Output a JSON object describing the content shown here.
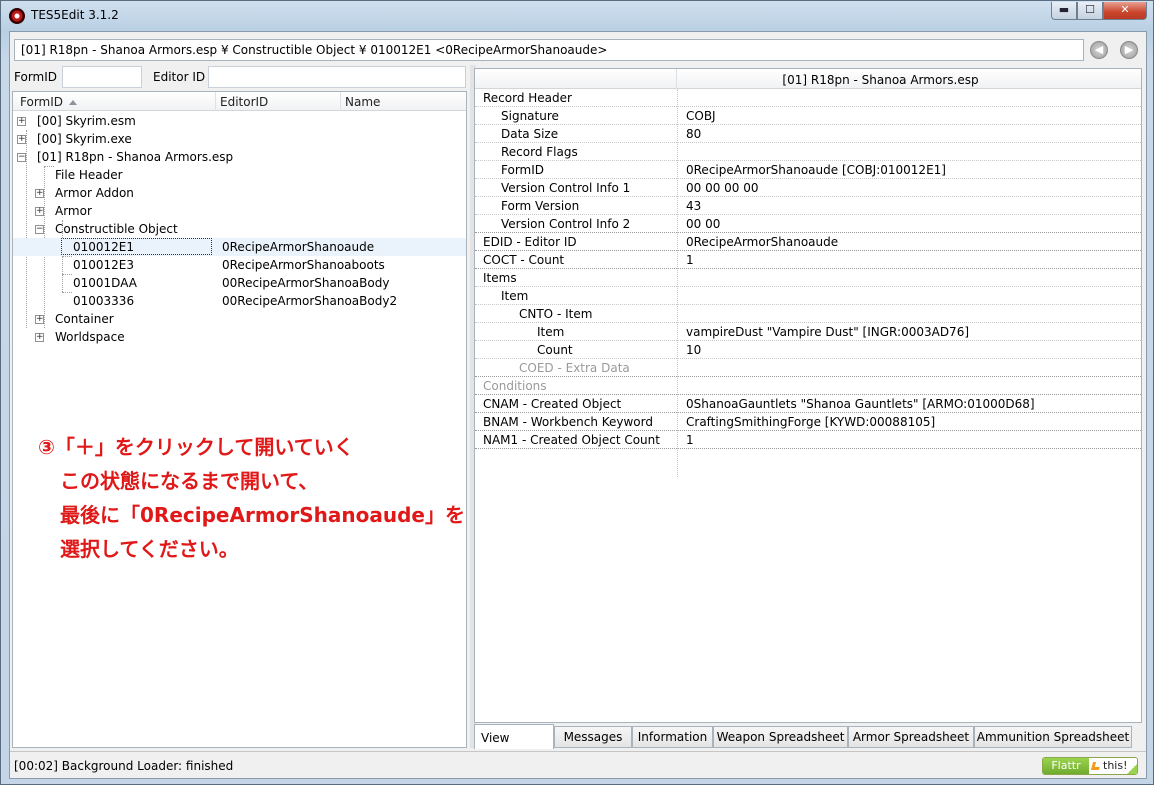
{
  "window": {
    "title": "TES5Edit 3.1.2",
    "buttons": {
      "minimize": "▬",
      "maximize": "☐",
      "close": "✕"
    }
  },
  "pathbar": {
    "text": "[01] R18pn - Shanoa Armors.esp ¥ Constructible Object ¥ 010012E1 <0RecipeArmorShanoaude>"
  },
  "filter": {
    "formid_label": "FormID",
    "editorid_label": "Editor ID",
    "formid_value": "",
    "editorid_value": ""
  },
  "tree": {
    "columns": [
      "FormID",
      "EditorID",
      "Name"
    ],
    "rows": [
      {
        "label": "[00] Skyrim.esm",
        "editorid": "",
        "expander": "+"
      },
      {
        "label": "[00] Skyrim.exe",
        "editorid": "",
        "expander": "+"
      },
      {
        "label": "[01] R18pn - Shanoa Armors.esp",
        "editorid": "",
        "expander": "−"
      },
      {
        "label": "File Header",
        "editorid": "",
        "expander": ""
      },
      {
        "label": "Armor Addon",
        "editorid": "",
        "expander": "+"
      },
      {
        "label": "Armor",
        "editorid": "",
        "expander": "+"
      },
      {
        "label": "Constructible Object",
        "editorid": "",
        "expander": "−"
      },
      {
        "label": "010012E1",
        "editorid": "0RecipeArmorShanoaude",
        "expander": ""
      },
      {
        "label": "010012E3",
        "editorid": "0RecipeArmorShanoaboots",
        "expander": ""
      },
      {
        "label": "01001DAA",
        "editorid": "00RecipeArmorShanoaBody",
        "expander": ""
      },
      {
        "label": "01003336",
        "editorid": "00RecipeArmorShanoaBody2",
        "expander": ""
      },
      {
        "label": "Container",
        "editorid": "",
        "expander": "+"
      },
      {
        "label": "Worldspace",
        "editorid": "",
        "expander": "+"
      }
    ]
  },
  "annotation": {
    "line1": "③「＋」をクリックして開いていく",
    "line2": "この状態になるまで開いて、",
    "line3": "最後に「0RecipeArmorShanoaude」を",
    "line4": "選択してください。"
  },
  "record_view": {
    "header": "[01] R18pn - Shanoa Armors.esp",
    "rows": [
      {
        "key": "Record Header",
        "value": ""
      },
      {
        "key": "Signature",
        "value": "COBJ"
      },
      {
        "key": "Data Size",
        "value": "80"
      },
      {
        "key": "Record Flags",
        "value": ""
      },
      {
        "key": "FormID",
        "value": "0RecipeArmorShanoaude [COBJ:010012E1]"
      },
      {
        "key": "Version Control Info 1",
        "value": "00 00 00 00"
      },
      {
        "key": "Form Version",
        "value": "43"
      },
      {
        "key": "Version Control Info 2",
        "value": "00 00"
      },
      {
        "key": "EDID - Editor ID",
        "value": "0RecipeArmorShanoaude"
      },
      {
        "key": "COCT - Count",
        "value": "1"
      },
      {
        "key": "Items",
        "value": ""
      },
      {
        "key": "Item",
        "value": ""
      },
      {
        "key": "CNTO - Item",
        "value": ""
      },
      {
        "key": "Item",
        "value": "vampireDust \"Vampire Dust\" [INGR:0003AD76]"
      },
      {
        "key": "Count",
        "value": "10"
      },
      {
        "key": "COED - Extra Data",
        "value": ""
      },
      {
        "key": "Conditions",
        "value": ""
      },
      {
        "key": "CNAM - Created Object",
        "value": "0ShanoaGauntlets \"Shanoa Gauntlets\" [ARMO:01000D68]"
      },
      {
        "key": "BNAM - Workbench Keyword",
        "value": "CraftingSmithingForge [KYWD:00088105]"
      },
      {
        "key": "NAM1 - Created Object Count",
        "value": "1"
      }
    ]
  },
  "tabs": [
    "View",
    "Messages",
    "Information",
    "Weapon Spreadsheet",
    "Armor Spreadsheet",
    "Ammunition Spreadsheet"
  ],
  "status": {
    "text": "[00:02] Background Loader: finished",
    "flattr_left": "Flattr",
    "flattr_right": "this!"
  },
  "colors": {
    "annotation": "#e01818",
    "selection": "#eaf3fc",
    "close_button": "#c9452c"
  }
}
